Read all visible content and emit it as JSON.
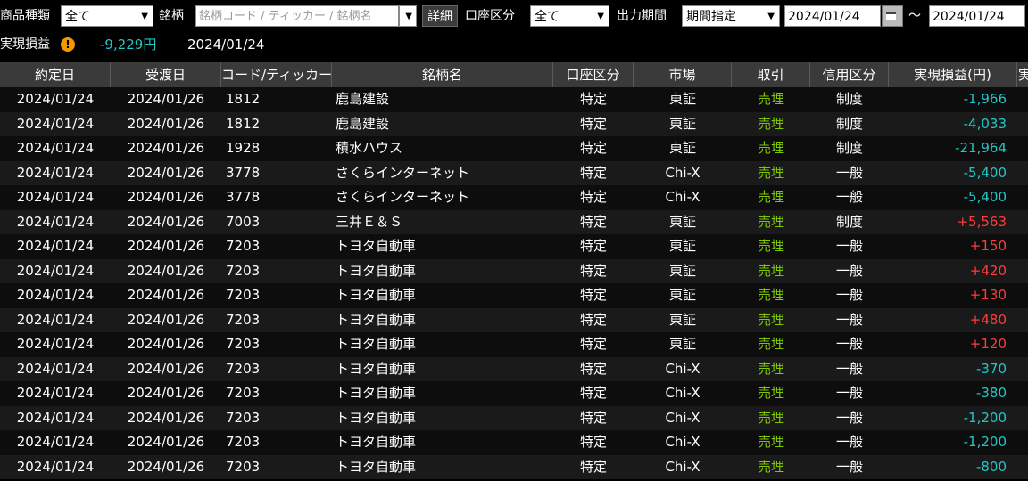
{
  "toolbar": {
    "product_label": "商品種類",
    "product_value": "全て",
    "stock_label": "銘柄",
    "stock_placeholder": "銘柄コード / ティッカー / 銘柄名",
    "detail_button": "詳細",
    "account_label": "口座区分",
    "account_value": "全て",
    "period_label": "出力期間",
    "period_value": "期間指定",
    "date_from": "2024/01/24",
    "tilde": "～",
    "date_to": "2024/01/24"
  },
  "summary": {
    "label": "実現損益",
    "warning": "!",
    "value": "-9,229円",
    "date": "2024/01/24"
  },
  "table": {
    "headers": [
      "約定日",
      "受渡日",
      "コード/ティッカー",
      "銘柄名",
      "口座区分",
      "市場",
      "取引",
      "信用区分",
      "実現損益(円)",
      "実"
    ],
    "rows": [
      {
        "trade_date": "2024/01/24",
        "settle_date": "2024/01/26",
        "code": "1812",
        "name": "鹿島建設",
        "account": "特定",
        "market": "東証",
        "trade": "売埋",
        "margin": "制度",
        "pnl": "-1,966",
        "sign": "neg"
      },
      {
        "trade_date": "2024/01/24",
        "settle_date": "2024/01/26",
        "code": "1812",
        "name": "鹿島建設",
        "account": "特定",
        "market": "東証",
        "trade": "売埋",
        "margin": "制度",
        "pnl": "-4,033",
        "sign": "neg"
      },
      {
        "trade_date": "2024/01/24",
        "settle_date": "2024/01/26",
        "code": "1928",
        "name": "積水ハウス",
        "account": "特定",
        "market": "東証",
        "trade": "売埋",
        "margin": "制度",
        "pnl": "-21,964",
        "sign": "neg"
      },
      {
        "trade_date": "2024/01/24",
        "settle_date": "2024/01/26",
        "code": "3778",
        "name": "さくらインターネット",
        "account": "特定",
        "market": "Chi-X",
        "trade": "売埋",
        "margin": "一般",
        "pnl": "-5,400",
        "sign": "neg"
      },
      {
        "trade_date": "2024/01/24",
        "settle_date": "2024/01/26",
        "code": "3778",
        "name": "さくらインターネット",
        "account": "特定",
        "market": "Chi-X",
        "trade": "売埋",
        "margin": "一般",
        "pnl": "-5,400",
        "sign": "neg"
      },
      {
        "trade_date": "2024/01/24",
        "settle_date": "2024/01/26",
        "code": "7003",
        "name": "三井Ｅ＆Ｓ",
        "account": "特定",
        "market": "東証",
        "trade": "売埋",
        "margin": "制度",
        "pnl": "+5,563",
        "sign": "pos"
      },
      {
        "trade_date": "2024/01/24",
        "settle_date": "2024/01/26",
        "code": "7203",
        "name": "トヨタ自動車",
        "account": "特定",
        "market": "東証",
        "trade": "売埋",
        "margin": "一般",
        "pnl": "+150",
        "sign": "pos"
      },
      {
        "trade_date": "2024/01/24",
        "settle_date": "2024/01/26",
        "code": "7203",
        "name": "トヨタ自動車",
        "account": "特定",
        "market": "東証",
        "trade": "売埋",
        "margin": "一般",
        "pnl": "+420",
        "sign": "pos"
      },
      {
        "trade_date": "2024/01/24",
        "settle_date": "2024/01/26",
        "code": "7203",
        "name": "トヨタ自動車",
        "account": "特定",
        "market": "東証",
        "trade": "売埋",
        "margin": "一般",
        "pnl": "+130",
        "sign": "pos"
      },
      {
        "trade_date": "2024/01/24",
        "settle_date": "2024/01/26",
        "code": "7203",
        "name": "トヨタ自動車",
        "account": "特定",
        "market": "東証",
        "trade": "売埋",
        "margin": "一般",
        "pnl": "+480",
        "sign": "pos"
      },
      {
        "trade_date": "2024/01/24",
        "settle_date": "2024/01/26",
        "code": "7203",
        "name": "トヨタ自動車",
        "account": "特定",
        "market": "東証",
        "trade": "売埋",
        "margin": "一般",
        "pnl": "+120",
        "sign": "pos"
      },
      {
        "trade_date": "2024/01/24",
        "settle_date": "2024/01/26",
        "code": "7203",
        "name": "トヨタ自動車",
        "account": "特定",
        "market": "Chi-X",
        "trade": "売埋",
        "margin": "一般",
        "pnl": "-370",
        "sign": "neg"
      },
      {
        "trade_date": "2024/01/24",
        "settle_date": "2024/01/26",
        "code": "7203",
        "name": "トヨタ自動車",
        "account": "特定",
        "market": "Chi-X",
        "trade": "売埋",
        "margin": "一般",
        "pnl": "-380",
        "sign": "neg"
      },
      {
        "trade_date": "2024/01/24",
        "settle_date": "2024/01/26",
        "code": "7203",
        "name": "トヨタ自動車",
        "account": "特定",
        "market": "Chi-X",
        "trade": "売埋",
        "margin": "一般",
        "pnl": "-1,200",
        "sign": "neg"
      },
      {
        "trade_date": "2024/01/24",
        "settle_date": "2024/01/26",
        "code": "7203",
        "name": "トヨタ自動車",
        "account": "特定",
        "market": "Chi-X",
        "trade": "売埋",
        "margin": "一般",
        "pnl": "-1,200",
        "sign": "neg"
      },
      {
        "trade_date": "2024/01/24",
        "settle_date": "2024/01/26",
        "code": "7203",
        "name": "トヨタ自動車",
        "account": "特定",
        "market": "Chi-X",
        "trade": "売埋",
        "margin": "一般",
        "pnl": "-800",
        "sign": "neg"
      }
    ]
  },
  "colors": {
    "positive": "#ff3c3c",
    "negative": "#21c7c7",
    "trade": "#7ec800",
    "header_bg": "#3a3a3a"
  },
  "icons": {
    "dropdown": "chevron-down-icon",
    "calendar": "calendar-icon",
    "warning": "warning-icon"
  }
}
